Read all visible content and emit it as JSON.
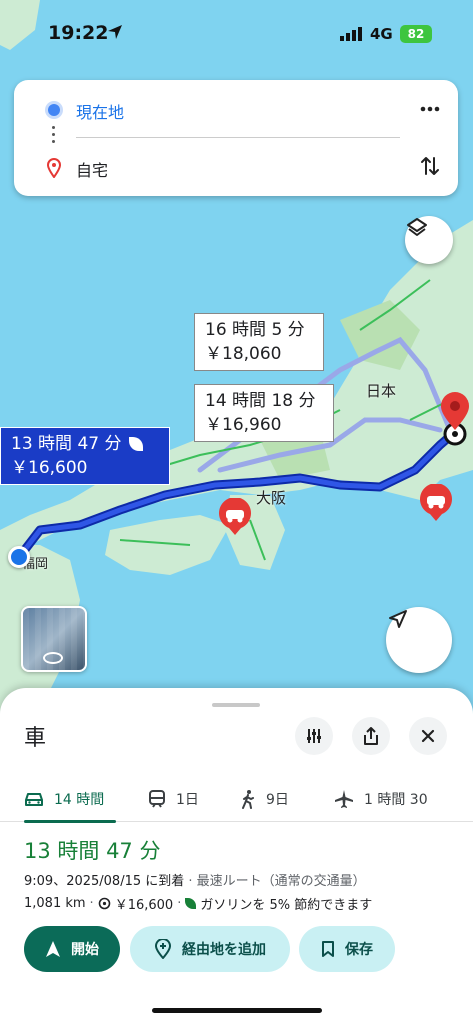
{
  "status_bar": {
    "time": "19:22",
    "network": "4G",
    "battery": "82"
  },
  "search": {
    "origin": "現在地",
    "destination": "自宅"
  },
  "map": {
    "labels": {
      "nihon": "日本",
      "osaka": "大阪",
      "fukuoka": "福岡"
    },
    "routes": [
      {
        "time": "13 時間 47 分",
        "price": "￥16,600",
        "selected": true
      },
      {
        "time": "14 時間 18 分",
        "price": "￥16,960",
        "selected": false
      },
      {
        "time": "16 時間 5 分",
        "price": "￥18,060",
        "selected": false
      }
    ]
  },
  "sheet": {
    "title": "車",
    "modes": [
      {
        "icon": "car-icon",
        "label": "14 時間"
      },
      {
        "icon": "train-icon",
        "label": "1日"
      },
      {
        "icon": "walk-icon",
        "label": "9日"
      },
      {
        "icon": "plane-icon",
        "label": "1 時間 30"
      }
    ],
    "duration": "13 時間 47 分",
    "arrival": "9:09、2025/08/15 に到着",
    "route_type": "最速ルート（通常の交通量）",
    "distance": "1,081 km",
    "toll": "￥16,600",
    "eco": "ガソリンを 5% 節約できます",
    "buttons": {
      "start": "開始",
      "add_stop": "経由地を追加",
      "save": "保存"
    }
  },
  "colors": {
    "route_primary": "#1a3cc6",
    "accent_green": "#0b6b58",
    "water": "#7fd3f0",
    "land": "#c8ead0"
  }
}
